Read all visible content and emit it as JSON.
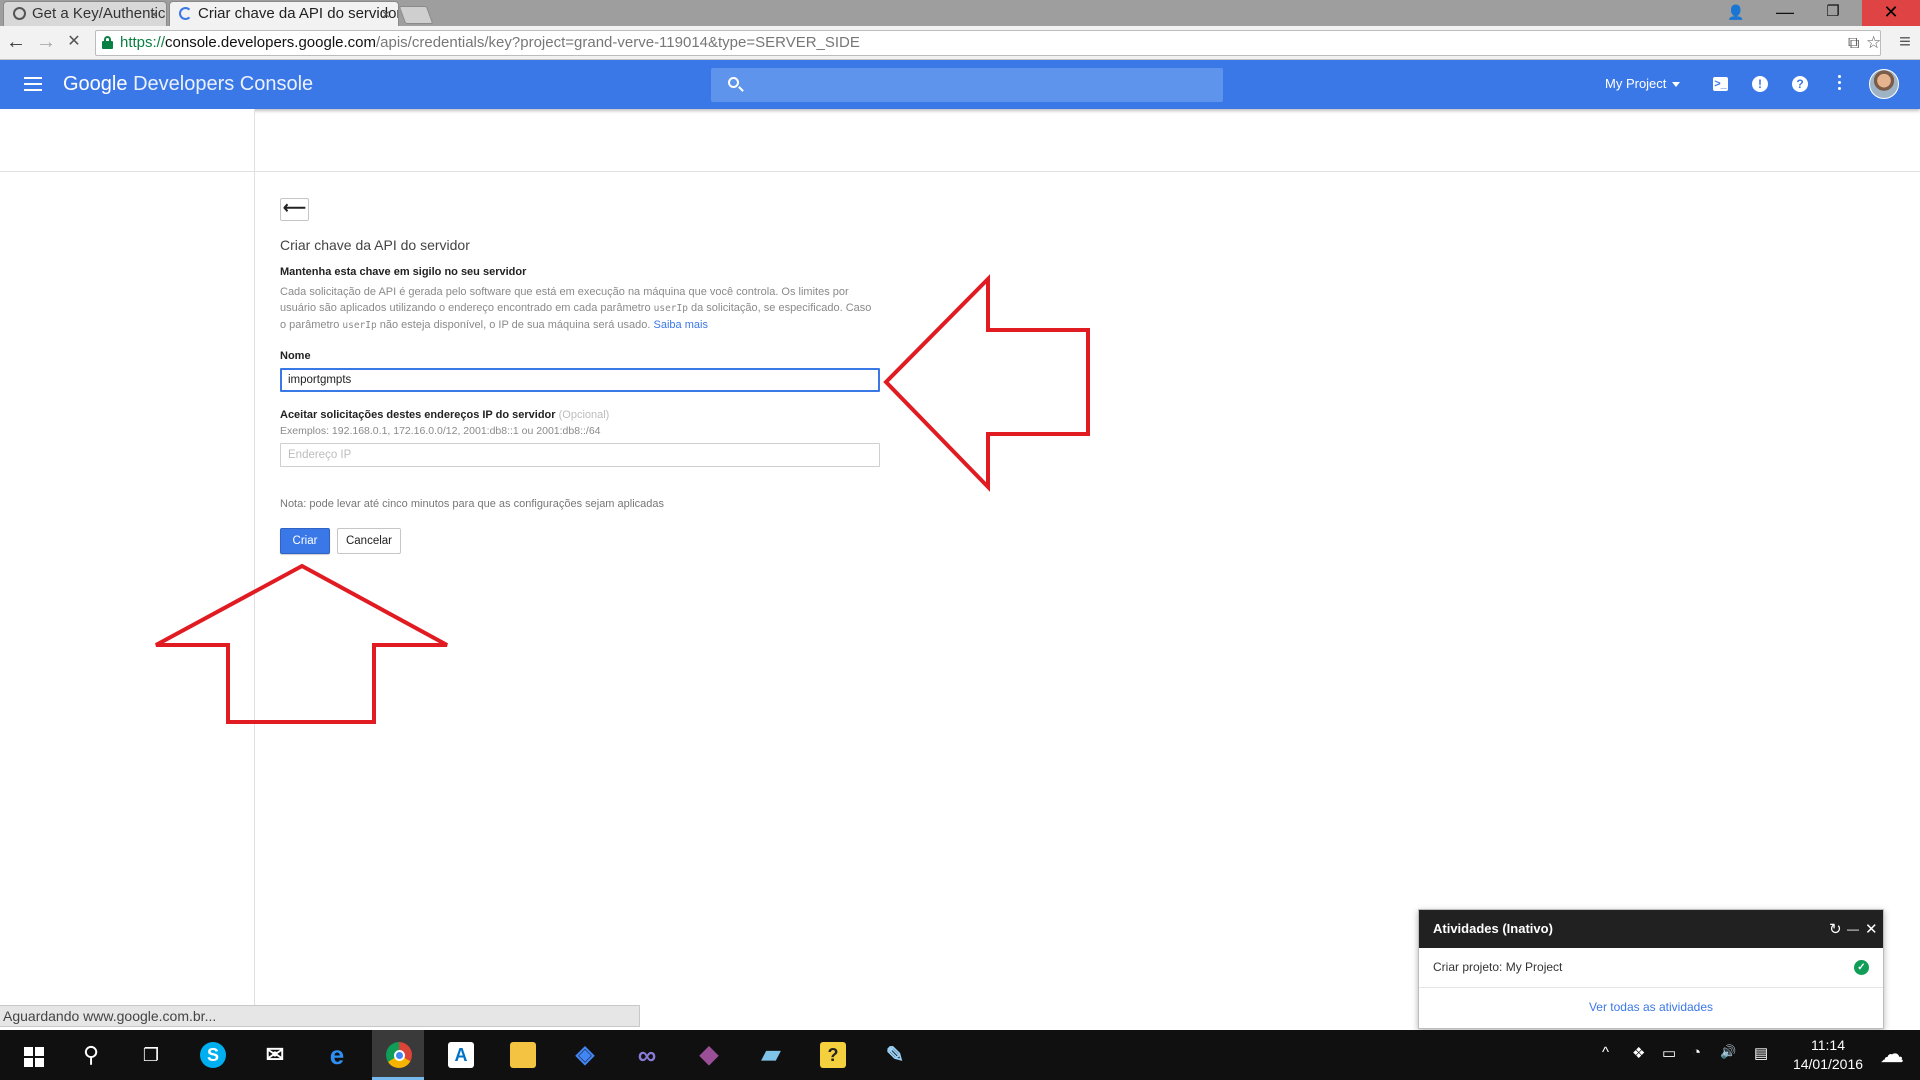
{
  "browser": {
    "tabs": [
      {
        "title": "Get a Key/Authentica",
        "close": "×"
      },
      {
        "title": "Criar chave da API do servidor",
        "close": "×"
      }
    ],
    "window_controls": {
      "minimize": "—",
      "maximize": "❐",
      "close": "✕"
    },
    "nav": {
      "back": "←",
      "forward": "→",
      "stop": "✕"
    },
    "url": {
      "scheme": "https://",
      "host": "console.developers.google.com",
      "path": "/apis/credentials/key?project=grand-verve-119014&type=SERVER_SIDE"
    },
    "omni_icons": {
      "translate": "⧉",
      "star": "☆",
      "menu": "≡"
    },
    "status_text": "Aguardando www.google.com.br..."
  },
  "header": {
    "brand_google": "Google",
    "brand_product": "Developers Console",
    "search_placeholder": "",
    "project_selector": "My Project",
    "icons": [
      "cloud-shell-icon",
      "notifications-icon",
      "help-icon",
      "more-icon",
      "avatar"
    ],
    "icon_glyphs": {
      "shell": ">_",
      "notifications": "!",
      "help": "?"
    }
  },
  "form": {
    "back_glyph": "⟵",
    "title": "Criar chave da API do servidor",
    "section_heading": "Mantenha esta chave em sigilo no seu servidor",
    "description": {
      "part1": "Cada solicitação de API é gerada pelo software que está em execução na máquina que você controla. Os limites por usuário são aplicados utilizando o endereço encontrado em cada parâmetro ",
      "code1": "userIp",
      "part2": " da solicitação, se especificado. Caso o parâmetro ",
      "code2": "userIp",
      "part3": " não esteja disponível, o IP de sua máquina será usado. ",
      "link": "Saiba mais"
    },
    "name_label": "Nome",
    "name_value": "importgmpts",
    "ip_label": "Aceitar solicitações destes endereços IP do servidor",
    "ip_optional": "(Opcional)",
    "ip_hint": "Exemplos: 192.168.0.1, 172.16.0.0/12, 2001:db8::1 ou 2001:db8::/64",
    "ip_placeholder": "Endereço IP",
    "note": "Nota: pode levar até cinco minutos para que as configurações sejam aplicadas",
    "create_button": "Criar",
    "cancel_button": "Cancelar"
  },
  "activities": {
    "title": "Atividades (Inativo)",
    "icons": {
      "refresh": "↻",
      "minimize": "—",
      "close": "✕"
    },
    "items": [
      {
        "text": "Criar projeto: My Project",
        "status": "✓"
      }
    ],
    "view_all": "Ver todas as atividades"
  },
  "taskbar": {
    "apps": [
      "start",
      "search",
      "task-view",
      "skype",
      "mail",
      "edge",
      "chrome",
      "azure",
      "file-explorer",
      "gcloud",
      "visual-studio-infinity",
      "visual-studio",
      "notes",
      "help-tool",
      "paint"
    ],
    "glyphs": {
      "search": "⚲",
      "task_view": "❐",
      "skype": "S",
      "mail": "✉",
      "edge": "e",
      "azure": "A",
      "file_explorer": "▬",
      "gcloud": "◈",
      "infinity": "∞",
      "visual_studio": "◆",
      "notes": "▰",
      "help_tool": "?",
      "paint": "✎"
    },
    "tray_glyphs": [
      "^",
      "❖",
      "▭",
      "◔",
      "🔊",
      "▤"
    ],
    "time": "11:14",
    "date": "14/01/2016"
  },
  "colors": {
    "brand_blue": "#3b78e7",
    "annotation_red": "#e11b22",
    "success_green": "#0f9d58"
  }
}
